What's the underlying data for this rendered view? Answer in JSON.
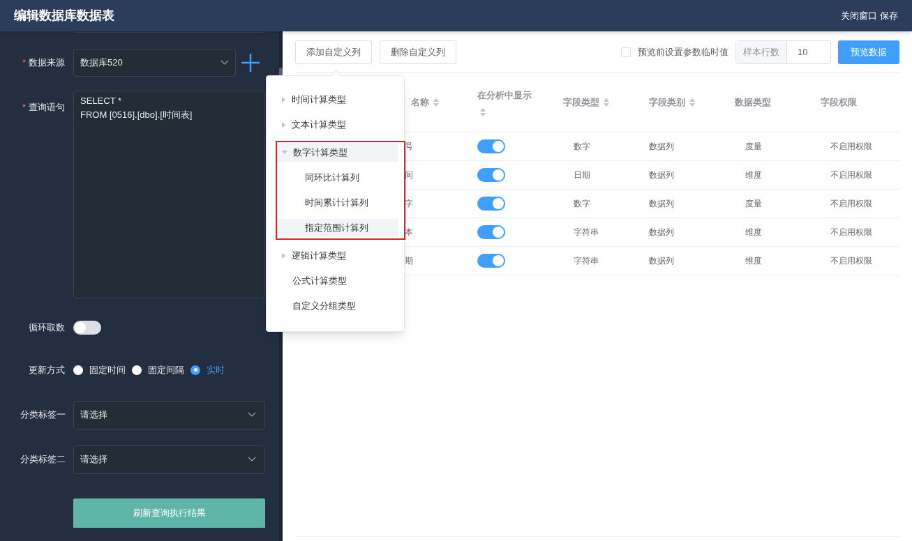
{
  "window": {
    "title": "编辑数据库数据表",
    "actions": [
      "关闭窗口",
      "保存"
    ]
  },
  "form": {
    "source": {
      "label": "数据来源",
      "required_mark": "*",
      "value": "数据库520"
    },
    "query": {
      "label": "查询语句",
      "required_mark": "*",
      "lines": [
        "SELECT *",
        "FROM [0516].[dbo].[时间表]"
      ]
    },
    "loop": {
      "label": "循环取数",
      "on": false
    },
    "update": {
      "label": "更新方式",
      "options": [
        {
          "label": "固定时间",
          "selected": false
        },
        {
          "label": "固定间隔",
          "selected": false
        },
        {
          "label": "实时",
          "selected": true
        }
      ]
    },
    "tags": [
      {
        "label": "分类标签一",
        "placeholder": "请选择"
      },
      {
        "label": "分类标签二",
        "placeholder": "请选择"
      }
    ],
    "refresh_button": "刷新查询执行结果"
  },
  "toolbar": {
    "buttons": [
      "添加自定义列",
      "删除自定义列"
    ],
    "param_checkbox": {
      "label": "预览前设置参数临时值",
      "checked": false
    },
    "sample_rows": {
      "label": "样本行数",
      "value": "10"
    },
    "preview_button": "预览数据"
  },
  "table": {
    "columns": [
      {
        "label": "名称",
        "sortable": true
      },
      {
        "label": "在分析中显示",
        "sortable": true
      },
      {
        "label": "字段类型",
        "sortable": true
      },
      {
        "label": "字段类别",
        "sortable": true
      },
      {
        "label": "数据类型",
        "sortable": false
      },
      {
        "label": "字段权限",
        "sortable": false
      }
    ],
    "rows": [
      {
        "name": "号",
        "show": true,
        "field_type": "数字",
        "category": "数据列",
        "data_type": "度量",
        "permission": "不启用权限"
      },
      {
        "name": "间",
        "show": true,
        "field_type": "日期",
        "category": "数据列",
        "data_type": "维度",
        "permission": "不启用权限"
      },
      {
        "name": "字",
        "show": true,
        "field_type": "数字",
        "category": "数据列",
        "data_type": "度量",
        "permission": "不启用权限"
      },
      {
        "name": "本",
        "show": true,
        "field_type": "字符串",
        "category": "数据列",
        "data_type": "维度",
        "permission": "不启用权限"
      },
      {
        "name": "期",
        "show": true,
        "field_type": "字符串",
        "category": "数据列",
        "data_type": "维度",
        "permission": "不启用权限"
      }
    ]
  },
  "menu": {
    "items": [
      {
        "label": "时间计算类型",
        "kind": "group",
        "expanded": false,
        "highlighted": false
      },
      {
        "label": "文本计算类型",
        "kind": "group",
        "expanded": false,
        "highlighted": false
      },
      {
        "label": "数字计算类型",
        "kind": "group",
        "expanded": true,
        "highlighted": true,
        "hovered": true,
        "children": [
          {
            "label": "同环比计算列",
            "hovered": false
          },
          {
            "label": "时间累计计算列",
            "hovered": false
          },
          {
            "label": "指定范围计算列",
            "hovered": true
          }
        ]
      },
      {
        "label": "逻辑计算类型",
        "kind": "group",
        "expanded": false,
        "highlighted": false
      },
      {
        "label": "公式计算类型",
        "kind": "item"
      },
      {
        "label": "自定义分组类型",
        "kind": "item"
      }
    ]
  }
}
